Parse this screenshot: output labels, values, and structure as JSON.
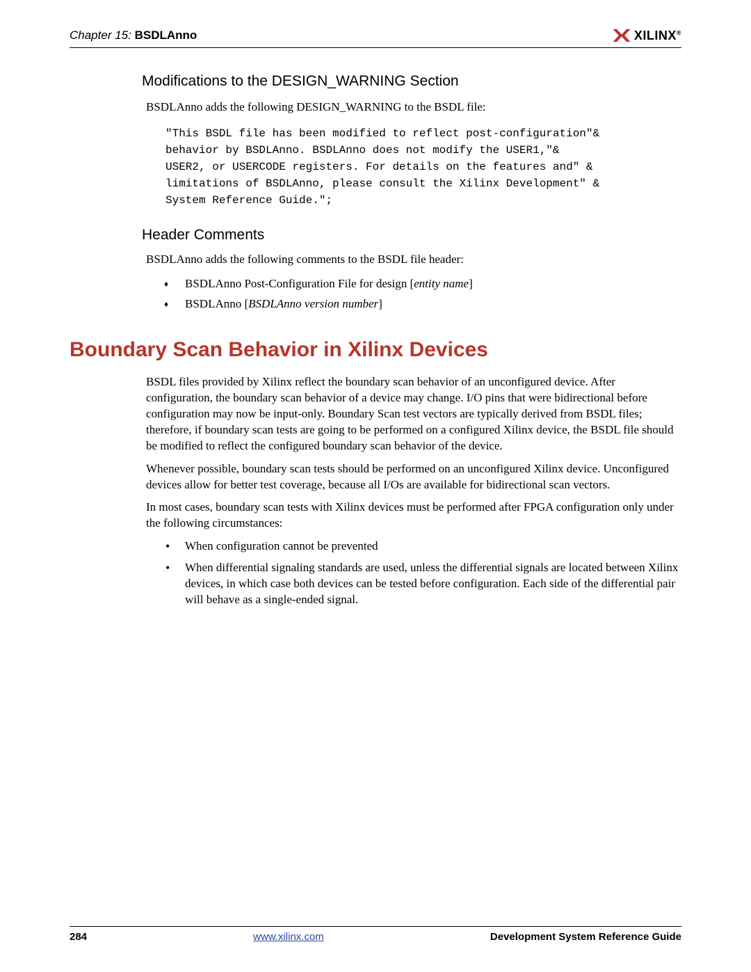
{
  "header": {
    "chapter_prefix": "Chapter 15:",
    "chapter_name": "BSDLAnno",
    "logo_text": "XILINX",
    "logo_reg": "®"
  },
  "section1": {
    "heading": "Modifications to the DESIGN_WARNING Section",
    "intro": "BSDLAnno adds the following DESIGN_WARNING to the BSDL file:",
    "code": "\"This BSDL file has been modified to reflect post-configuration\"&\nbehavior by BSDLAnno. BSDLAnno does not modify the USER1,\"&\nUSER2, or USERCODE registers. For details on the features and\" &\nlimitations of BSDLAnno, please consult the Xilinx Development\" &\nSystem Reference Guide.\";"
  },
  "section2": {
    "heading": "Header Comments",
    "intro": "BSDLAnno adds the following comments to the BSDL file header:",
    "items": [
      {
        "pre": "BSDLAnno Post-Configuration File for design [",
        "it": "entity name",
        "post": "]"
      },
      {
        "pre": "BSDLAnno [",
        "it": "BSDLAnno version number",
        "post": "]"
      }
    ]
  },
  "main": {
    "heading": "Boundary Scan Behavior in Xilinx Devices",
    "p1": "BSDL files provided by Xilinx reflect the boundary scan behavior of an unconfigured device. After configuration, the boundary scan behavior of a device may change. I/O pins that were bidirectional before configuration may now be input-only. Boundary Scan test vectors are typically derived from BSDL files; therefore, if boundary scan tests are going to be performed on a configured Xilinx device, the BSDL file should be modified to reflect the configured boundary scan behavior of the device.",
    "p2": "Whenever possible, boundary scan tests should be performed on an unconfigured Xilinx device. Unconfigured devices allow for better test coverage, because all I/Os are available for bidirectional scan vectors.",
    "p3": "In most cases, boundary scan tests with Xilinx devices must be performed after FPGA configuration only under the following circumstances:",
    "bullets": [
      "When configuration cannot be prevented",
      "When differential signaling standards are used, unless the differential signals are located between Xilinx devices, in which case both devices can be tested before configuration. Each side of the differential pair will behave as a single-ended signal."
    ]
  },
  "footer": {
    "page": "284",
    "url": "www.xilinx.com",
    "guide": "Development System Reference Guide"
  }
}
